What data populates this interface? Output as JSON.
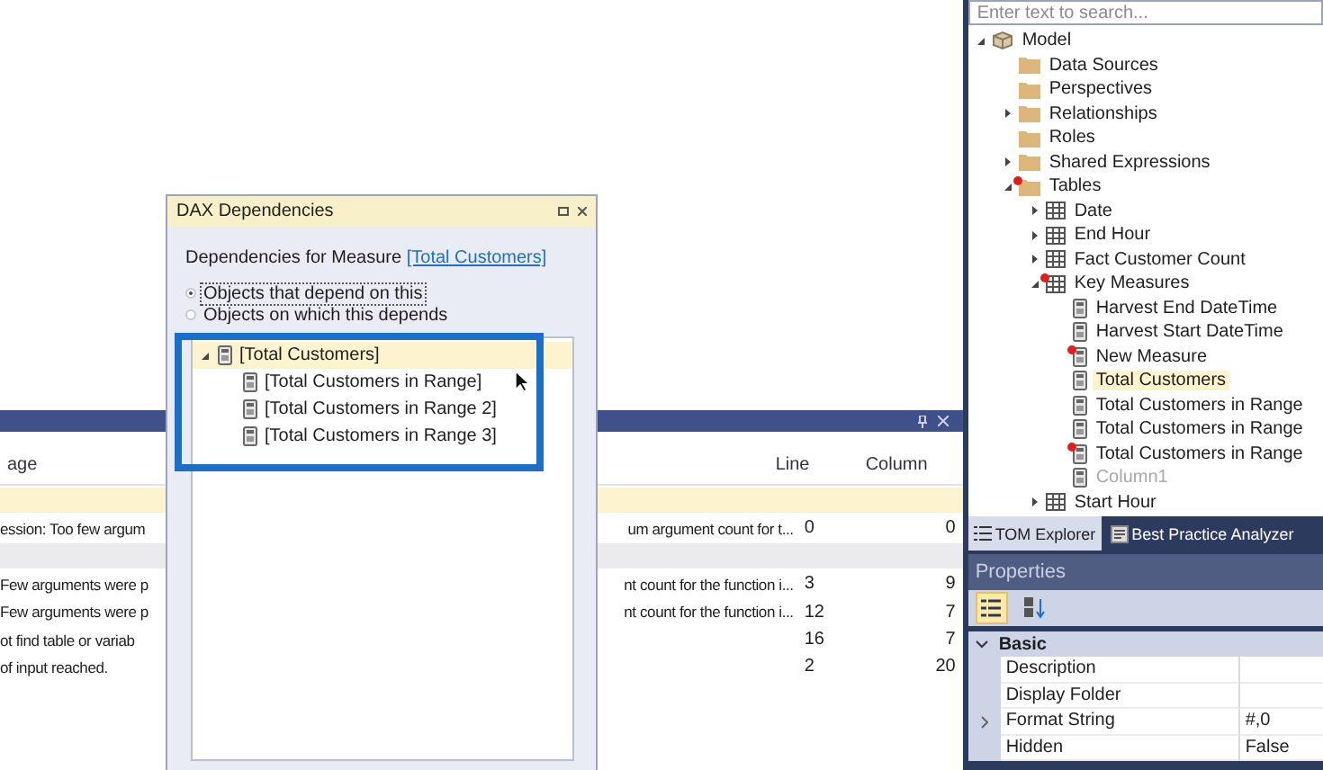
{
  "error_list": {
    "columns": [
      "age",
      "Line",
      "Column"
    ],
    "rows": [
      {
        "kind": "group",
        "selected": true
      },
      {
        "kind": "error",
        "message_start": "ession: Too few argum",
        "message_end": "um argument count for t...",
        "line": "0",
        "column": "0"
      },
      {
        "kind": "group",
        "selected": false
      },
      {
        "kind": "error",
        "message_start": "Few arguments were p",
        "message_end": "nt count for the function i...",
        "line": "3",
        "column": "9"
      },
      {
        "kind": "error",
        "message_start": "Few arguments were p",
        "message_end": "nt count for the function i...",
        "line": "12",
        "column": "7"
      },
      {
        "kind": "error",
        "message_start": "ot find table or variab",
        "message_end": "",
        "line": "16",
        "column": "7"
      },
      {
        "kind": "error",
        "message_start": "of input reached.",
        "message_end": "",
        "line": "2",
        "column": "20"
      }
    ]
  },
  "dialog": {
    "title": "DAX Dependencies",
    "heading": "Dependencies for Measure ",
    "heading_link": "[Total Customers]",
    "options": [
      {
        "label": "Objects that depend on this",
        "selected": true
      },
      {
        "label": "Objects on which this depends",
        "selected": false
      }
    ],
    "tree": [
      {
        "label": "[Total Customers]",
        "expanded": true,
        "selected": true,
        "children": [
          {
            "label": "[Total Customers in Range]",
            "selected": false
          },
          {
            "label": "[Total Customers in Range 2]",
            "selected": false
          },
          {
            "label": "[Total Customers in Range 3]",
            "selected": false
          }
        ]
      }
    ]
  },
  "explorer": {
    "search": {
      "placeholder": "Enter text to search..."
    },
    "tree": [
      {
        "label": "Model",
        "kind": "model",
        "expanded": true,
        "children": [
          {
            "label": "Data Sources",
            "kind": "folder"
          },
          {
            "label": "Perspectives",
            "kind": "folder"
          },
          {
            "label": "Relationships",
            "kind": "folder",
            "expanded": false
          },
          {
            "label": "Roles",
            "kind": "folder"
          },
          {
            "label": "Shared Expressions",
            "kind": "folder",
            "expanded": false
          },
          {
            "label": "Tables",
            "kind": "folder",
            "expanded": true,
            "flagged": true,
            "children": [
              {
                "label": "Date",
                "kind": "table",
                "expanded": false
              },
              {
                "label": "End Hour",
                "kind": "table",
                "expanded": false
              },
              {
                "label": "Fact Customer Count",
                "kind": "table",
                "expanded": false
              },
              {
                "label": "Key Measures",
                "kind": "table",
                "expanded": true,
                "flagged": true,
                "children": [
                  {
                    "label": "Harvest End DateTime",
                    "kind": "measure"
                  },
                  {
                    "label": "Harvest Start DateTime",
                    "kind": "measure"
                  },
                  {
                    "label": "New Measure",
                    "kind": "measure",
                    "flagged": true
                  },
                  {
                    "label": "Total Customers",
                    "kind": "measure",
                    "selected": true
                  },
                  {
                    "label": "Total Customers in Range",
                    "kind": "measure"
                  },
                  {
                    "label": "Total Customers in Range",
                    "kind": "measure"
                  },
                  {
                    "label": "Total Customers in Range",
                    "kind": "measure",
                    "flagged": true
                  },
                  {
                    "label": "Column1",
                    "kind": "measure",
                    "disabled": true
                  }
                ]
              },
              {
                "label": "Start Hour",
                "kind": "table",
                "expanded": false
              }
            ]
          }
        ]
      }
    ],
    "tabs": [
      {
        "label": "TOM Explorer",
        "selected": true
      },
      {
        "label": "Best Practice Analyzer",
        "selected": false
      }
    ]
  },
  "properties": {
    "title": "Properties",
    "category": "Basic",
    "category_expanded": true,
    "rows": [
      {
        "name": "Description",
        "value": ""
      },
      {
        "name": "Display Folder",
        "value": ""
      },
      {
        "name": "Format String",
        "value": "#,0",
        "expanded": false
      },
      {
        "name": "Hidden",
        "value": "False"
      }
    ]
  }
}
